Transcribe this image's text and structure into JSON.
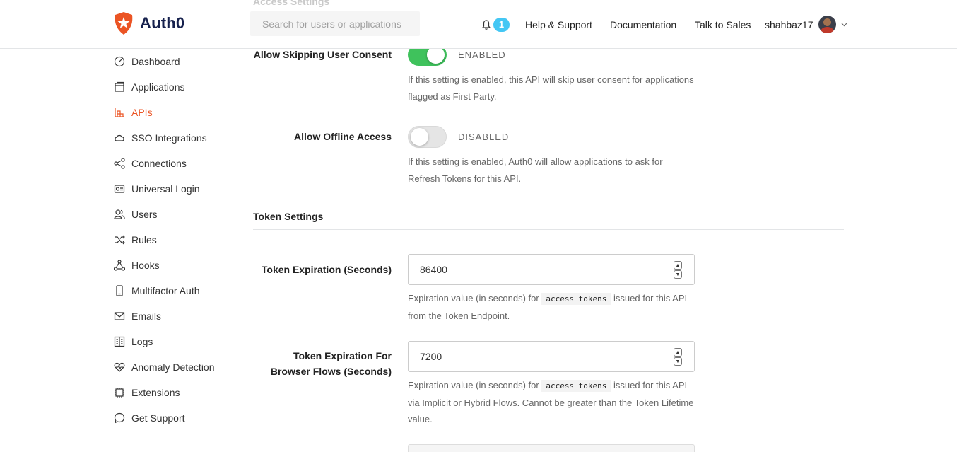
{
  "header": {
    "logo_text": "Auth0",
    "search_placeholder": "Search for users or applications",
    "notification_count": "1",
    "links": [
      "Help & Support",
      "Documentation",
      "Talk to Sales"
    ],
    "username": "shahbaz17",
    "ghost_section": "Access Settings"
  },
  "sidebar": {
    "items": [
      {
        "label": "Dashboard",
        "icon": "dashboard-icon"
      },
      {
        "label": "Applications",
        "icon": "applications-icon"
      },
      {
        "label": "APIs",
        "icon": "apis-icon",
        "active": true
      },
      {
        "label": "SSO Integrations",
        "icon": "sso-icon"
      },
      {
        "label": "Connections",
        "icon": "connections-icon"
      },
      {
        "label": "Universal Login",
        "icon": "universal-login-icon"
      },
      {
        "label": "Users",
        "icon": "users-icon"
      },
      {
        "label": "Rules",
        "icon": "rules-icon"
      },
      {
        "label": "Hooks",
        "icon": "hooks-icon"
      },
      {
        "label": "Multifactor Auth",
        "icon": "mfa-icon"
      },
      {
        "label": "Emails",
        "icon": "emails-icon"
      },
      {
        "label": "Logs",
        "icon": "logs-icon"
      },
      {
        "label": "Anomaly Detection",
        "icon": "anomaly-icon"
      },
      {
        "label": "Extensions",
        "icon": "extensions-icon"
      },
      {
        "label": "Get Support",
        "icon": "support-icon"
      }
    ]
  },
  "access": {
    "skip_consent": {
      "label": "Allow Skipping User Consent",
      "state": "ENABLED",
      "help": "If this setting is enabled, this API will skip user consent for applications flagged as First Party."
    },
    "offline_access": {
      "label": "Allow Offline Access",
      "state": "DISABLED",
      "help": "If this setting is enabled, Auth0 will allow applications to ask for Refresh Tokens for this API."
    }
  },
  "token": {
    "section_title": "Token Settings",
    "expiration": {
      "label": "Token Expiration (Seconds)",
      "value": "86400",
      "help_pre": "Expiration value (in seconds) for",
      "help_code": "access tokens",
      "help_post": "issued for this API from the Token Endpoint."
    },
    "browser_expiration": {
      "label": "Token Expiration For Browser Flows (Seconds)",
      "value": "7200",
      "help_pre": "Expiration value (in seconds) for",
      "help_code": "access tokens",
      "help_post": "issued for this API via Implicit or Hybrid Flows. Cannot be greater than the Token Lifetime value."
    }
  },
  "colors": {
    "accent": "#eb5424",
    "toggle_on": "#3fc25c",
    "badge": "#44c7f4"
  }
}
